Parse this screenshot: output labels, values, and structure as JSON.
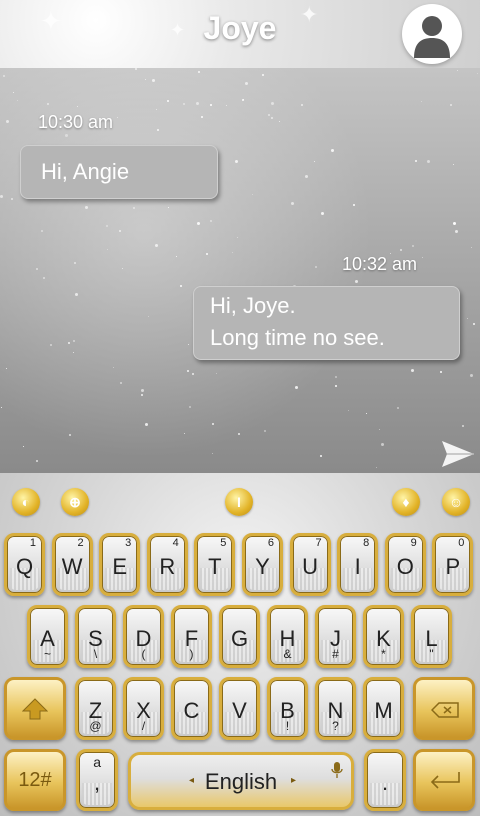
{
  "header": {
    "title": "Joye",
    "avatar_icon": "person-icon"
  },
  "messages": [
    {
      "time": "10:30 am",
      "lines": [
        "Hi, Angie"
      ],
      "direction": "incoming"
    },
    {
      "time": "10:32 am",
      "lines": [
        "Hi, Joye.",
        "Long time no see."
      ],
      "direction": "outgoing"
    }
  ],
  "send_icon": "send-icon",
  "toolbar": [
    "emoji-app-icon",
    "globe-icon",
    "cursor-edit-icon",
    "theme-shirt-icon",
    "smiley-icon"
  ],
  "keyboard": {
    "row1": [
      {
        "ch": "Q",
        "sub": "1"
      },
      {
        "ch": "W",
        "sub": "2"
      },
      {
        "ch": "E",
        "sub": "3"
      },
      {
        "ch": "R",
        "sub": "4"
      },
      {
        "ch": "T",
        "sub": "5"
      },
      {
        "ch": "Y",
        "sub": "6"
      },
      {
        "ch": "U",
        "sub": "7"
      },
      {
        "ch": "I",
        "sub": "8"
      },
      {
        "ch": "O",
        "sub": "9"
      },
      {
        "ch": "P",
        "sub": "0"
      }
    ],
    "row2": [
      {
        "ch": "A",
        "sub2": "~"
      },
      {
        "ch": "S",
        "sub2": "\\"
      },
      {
        "ch": "D",
        "sub2": "("
      },
      {
        "ch": "F",
        "sub2": ")"
      },
      {
        "ch": "G",
        "sub2": ""
      },
      {
        "ch": "H",
        "sub2": "&"
      },
      {
        "ch": "J",
        "sub2": "#"
      },
      {
        "ch": "K",
        "sub2": "*"
      },
      {
        "ch": "L",
        "sub2": "\""
      }
    ],
    "row3": [
      {
        "ch": "Z",
        "sub2": "@"
      },
      {
        "ch": "X",
        "sub2": "/"
      },
      {
        "ch": "C",
        "sub2": ""
      },
      {
        "ch": "V",
        "sub2": ""
      },
      {
        "ch": "B",
        "sub2": "!"
      },
      {
        "ch": "N",
        "sub2": "?"
      },
      {
        "ch": "M",
        "sub2": ""
      }
    ],
    "symbols_label": "12#",
    "comma_key": ",",
    "comma_sub": "a",
    "period_key": ".",
    "space_label": "English",
    "space_left_arrow": "◂",
    "space_right_arrow": "▸",
    "shift_icon": "shift-up-icon",
    "delete_icon": "backspace-icon",
    "enter_icon": "enter-icon",
    "colors": {
      "gold": "#d8ae3d",
      "dark_gold": "#c9962a"
    }
  }
}
